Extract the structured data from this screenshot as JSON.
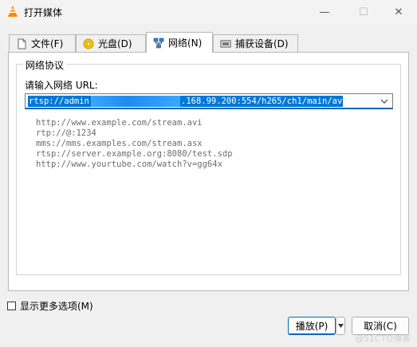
{
  "window": {
    "title": "打开媒体",
    "minimize_glyph": "—",
    "maximize_glyph": "☐",
    "close_glyph": "✕"
  },
  "tabs": [
    {
      "label": "文件(F)",
      "icon": "file-icon"
    },
    {
      "label": "光盘(D)",
      "icon": "disc-icon"
    },
    {
      "label": "网络(N)",
      "icon": "network-icon",
      "active": true
    },
    {
      "label": "捕获设备(D)",
      "icon": "capture-device-icon"
    }
  ],
  "network": {
    "group_title": "网络协议",
    "url_label": "请输入网络 URL:",
    "url_value_prefix": "rtsp://admin:",
    "url_value_suffix": ".168.99.200:554/h265/ch1/main/av",
    "examples": [
      "http://www.example.com/stream.avi",
      "rtp://@:1234",
      "mms://mms.examples.com/stream.asx",
      "rtsp://server.example.org:8080/test.sdp",
      "http://www.yourtube.com/watch?v=gg64x"
    ]
  },
  "options": {
    "show_more_label": "显示更多选项(M)",
    "checked": false
  },
  "buttons": {
    "play": "播放(P)",
    "cancel": "取消(C)"
  },
  "watermark": "@51CTO博客",
  "colors": {
    "accent": "#0078d7",
    "vlc_orange": "#ff8800"
  }
}
